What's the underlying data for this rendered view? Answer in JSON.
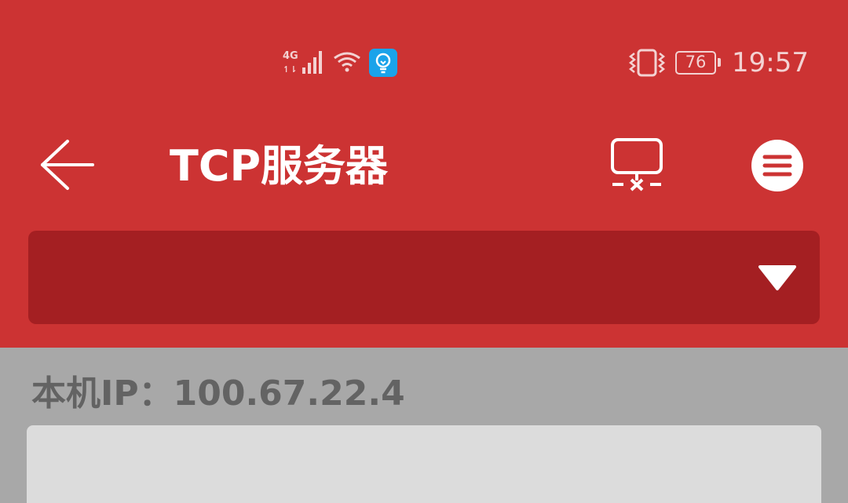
{
  "status_bar": {
    "network_label": "4G",
    "battery_level": "76",
    "time": "19:57",
    "icons": [
      "signal-4g-icon",
      "wifi-icon",
      "lightbulb-app-icon",
      "vibrate-icon",
      "battery-icon"
    ]
  },
  "toolbar": {
    "title": "TCP服务器",
    "back_icon": "arrow-left-icon",
    "disconnect_icon": "monitor-disconnect-icon",
    "menu_icon": "menu-circle-icon"
  },
  "dropdown": {
    "selected_value": "",
    "arrow_icon": "triangle-down-icon"
  },
  "content": {
    "ip_label": "本机IP：",
    "ip_value": "100.67.22.4",
    "message_text": ""
  },
  "colors": {
    "primary": "#cc3333",
    "primary_dark": "#a41f22",
    "content_bg": "#a8a8a8",
    "text_gray": "#636363",
    "panel_bg": "#dcdcdc"
  }
}
